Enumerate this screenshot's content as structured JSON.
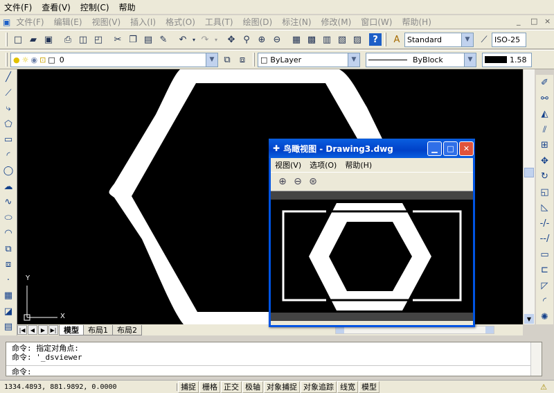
{
  "outer_menu": [
    "文件(F)",
    "查看(V)",
    "控制(C)",
    "帮助"
  ],
  "inner_menu": [
    "文件(F)",
    "编辑(E)",
    "视图(V)",
    "插入(I)",
    "格式(O)",
    "工具(T)",
    "绘图(D)",
    "标注(N)",
    "修改(M)",
    "窗口(W)",
    "帮助(H)"
  ],
  "inner_window_controls": [
    "_",
    "□",
    "×"
  ],
  "toolbar1": {
    "style_combo": "Standard",
    "dim_combo": "ISO-25"
  },
  "toolbar2": {
    "layer_combo": "0",
    "color_combo": "ByLayer",
    "linetype_combo": "ByBlock",
    "lineweight_combo": "1.58"
  },
  "canvas": {
    "axis_y": "Y",
    "axis_x": "X"
  },
  "tabs": [
    "模型",
    "布局1",
    "布局2"
  ],
  "command": {
    "lines": [
      "命令: 指定对角点:",
      "命令: '_dsviewer"
    ],
    "prompt": "命令:"
  },
  "status": {
    "coords": "1334.4893, 881.9892, 0.0000",
    "buttons": [
      "捕捉",
      "栅格",
      "正交",
      "极轴",
      "对象捕捉",
      "对象追踪",
      "线宽",
      "模型"
    ]
  },
  "aerial": {
    "title": "鸟瞰视图 - Drawing3.dwg",
    "menu": [
      "视图(V)",
      "选项(O)",
      "帮助(H)"
    ]
  },
  "colors": {
    "canvas_bg": "#000000",
    "drawing_fg": "#ffffff",
    "title_blue": "#0054e3"
  }
}
